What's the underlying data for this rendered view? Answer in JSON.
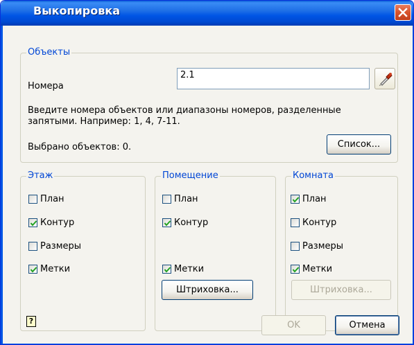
{
  "window": {
    "title": "Выкопировка"
  },
  "objects": {
    "legend": "Объекты",
    "numbers_label": "Номера",
    "numbers_value": "2.1",
    "hint_line1": "Введите номера объектов или диапазоны номеров, разделенные",
    "hint_line2": "запятыми. Например: 1, 4, 7-11.",
    "selected_count": "Выбрано объектов: 0.",
    "list_button": "Список..."
  },
  "floor": {
    "legend": "Этаж",
    "items": [
      {
        "label": "План",
        "checked": false
      },
      {
        "label": "Контур",
        "checked": true
      },
      {
        "label": "Размеры",
        "checked": false
      },
      {
        "label": "Метки",
        "checked": true
      }
    ]
  },
  "room": {
    "legend": "Помещение",
    "items": [
      {
        "label": "План",
        "checked": false
      },
      {
        "label": "Контур",
        "checked": true
      },
      {
        "label": "Метки",
        "checked": true
      }
    ],
    "hatch_button": "Штриховка..."
  },
  "chamber": {
    "legend": "Комната",
    "items": [
      {
        "label": "План",
        "checked": true
      },
      {
        "label": "Контур",
        "checked": false
      },
      {
        "label": "Размеры",
        "checked": false
      },
      {
        "label": "Метки",
        "checked": true
      }
    ],
    "hatch_button": "Штриховка..."
  },
  "footer": {
    "help_glyph": "?",
    "ok_button": "OK",
    "cancel_button": "Отмена"
  },
  "colors": {
    "titlebar": "#0055e5",
    "legend_text": "#0046d5",
    "check": "#21a121"
  }
}
